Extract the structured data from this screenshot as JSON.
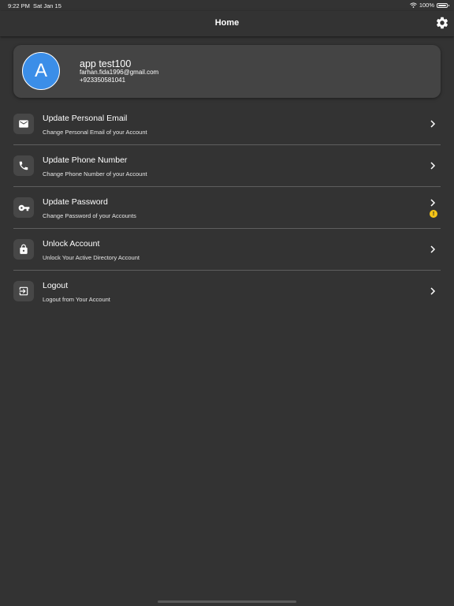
{
  "status_bar": {
    "time": "9:22 PM",
    "date": "Sat Jan 15",
    "battery": "100%"
  },
  "nav": {
    "title": "Home"
  },
  "profile": {
    "avatar_letter": "A",
    "name": "app test100",
    "email": "farhan.fida1996@gmail.com",
    "phone": "+923350581041"
  },
  "menu": [
    {
      "title": "Update Personal Email",
      "subtitle": "Change Personal Email of your Account",
      "icon": "mail-icon"
    },
    {
      "title": "Update Phone Number",
      "subtitle": "Change Phone Number of your Account",
      "icon": "phone-icon"
    },
    {
      "title": "Update Password",
      "subtitle": "Change Password of your Accounts",
      "icon": "key-icon",
      "warning_badge": "!"
    },
    {
      "title": "Unlock Account",
      "subtitle": "Unlock Your Active Directory Account",
      "icon": "lock-icon"
    },
    {
      "title": "Logout",
      "subtitle": "Logout from Your Account",
      "icon": "logout-icon"
    }
  ],
  "colors": {
    "background": "#333333",
    "card": "#444444",
    "avatar": "#3b8ee8",
    "warning": "#f5c518"
  }
}
